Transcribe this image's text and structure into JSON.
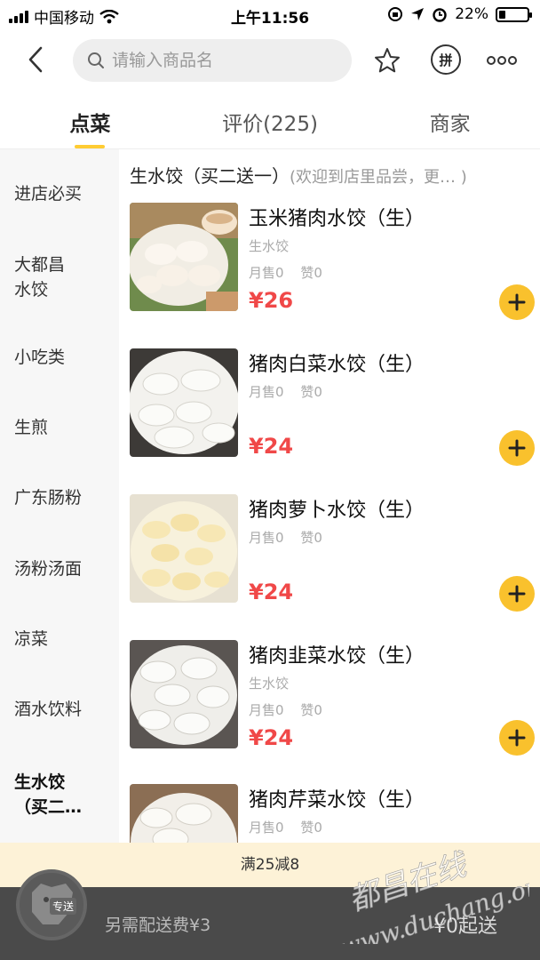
{
  "status_bar": {
    "carrier": "中国移动",
    "time": "上午11:56",
    "battery": "22%",
    "battery_level": 0.22
  },
  "header": {
    "search_placeholder": "请输入商品名",
    "pin_label": "拼"
  },
  "tabs": [
    {
      "label": "点菜",
      "active": true
    },
    {
      "label": "评价(225)",
      "active": false
    },
    {
      "label": "商家",
      "active": false
    }
  ],
  "sidebar": {
    "items": [
      {
        "label": "进店必买"
      },
      {
        "label": "大都昌\n水饺"
      },
      {
        "label": "小吃类"
      },
      {
        "label": "生煎"
      },
      {
        "label": "广东肠粉"
      },
      {
        "label": "汤粉汤面"
      },
      {
        "label": "凉菜"
      },
      {
        "label": "酒水饮料"
      },
      {
        "label": "生水饺\n（买二…",
        "active": true
      }
    ]
  },
  "section": {
    "title": "生水饺（买二送一）",
    "subtitle": "(欢迎到店里品尝，更…  )"
  },
  "products": [
    {
      "name": "玉米猪肉水饺（生）",
      "desc": "生水饺",
      "sold": "月售0",
      "likes": "赞0",
      "price": "¥26"
    },
    {
      "name": "猪肉白菜水饺（生）",
      "desc": "",
      "sold": "月售0",
      "likes": "赞0",
      "price": "¥24"
    },
    {
      "name": "猪肉萝卜水饺（生）",
      "desc": "",
      "sold": "月售0",
      "likes": "赞0",
      "price": "¥24"
    },
    {
      "name": "猪肉韭菜水饺（生）",
      "desc": "生水饺",
      "sold": "月售0",
      "likes": "赞0",
      "price": "¥24"
    },
    {
      "name": "猪肉芹菜水饺（生）",
      "desc": "",
      "sold": "月售0",
      "likes": "赞0",
      "price": ""
    }
  ],
  "promo": "满25减8",
  "cart": {
    "badge": "专送",
    "delivery_fee": "另需配送费¥3",
    "min_order": "¥0起送"
  },
  "watermark": {
    "text1": "都昌在线",
    "text2": "www.duchang.org"
  },
  "colors": {
    "accent": "#ffcc33",
    "price": "#f04848",
    "add_button": "#f9c12d",
    "promo_bg": "#fdf2d7",
    "cart_bg": "#4a4a4a"
  }
}
